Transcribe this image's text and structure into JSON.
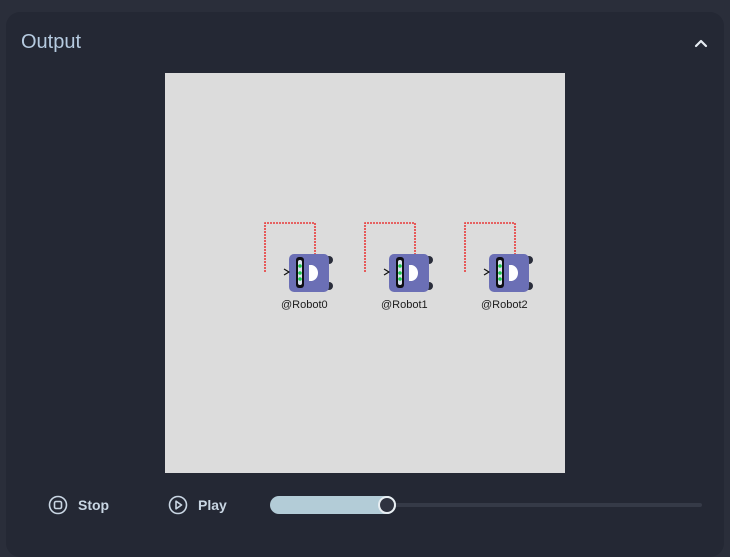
{
  "output": {
    "title": "Output"
  },
  "robots": [
    {
      "label": "@Robot0"
    },
    {
      "label": "@Robot1"
    },
    {
      "label": "@Robot2"
    }
  ],
  "controls": {
    "stop_label": "Stop",
    "play_label": "Play",
    "progress": 0.27
  },
  "colors": {
    "canvas_bg": "#dcdcdc",
    "robot_body": "#6b6fb5",
    "path_line": "#e83a3a",
    "accent": "#b3ccd7"
  },
  "icons": {
    "collapse": "chevron-up-icon",
    "stop": "stop-circle-icon",
    "play": "play-circle-icon"
  }
}
